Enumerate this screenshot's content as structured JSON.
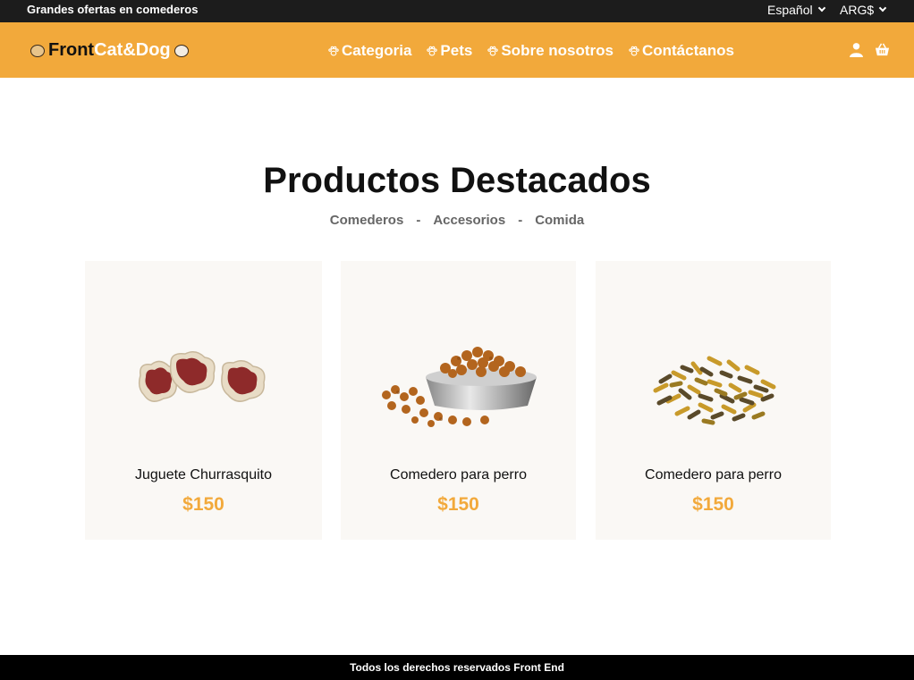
{
  "topbar": {
    "promo": "Grandes ofertas en comederos",
    "language": "Español",
    "currency": "ARG$"
  },
  "brand": {
    "part1": "Front",
    "part2": "Cat&Dog"
  },
  "nav": {
    "items": [
      {
        "label": "Categoria"
      },
      {
        "label": "Pets"
      },
      {
        "label": "Sobre nosotros"
      },
      {
        "label": "Contáctanos"
      }
    ]
  },
  "main": {
    "title": "Productos Destacados",
    "filters": [
      "Comederos",
      "Accesorios",
      "Comida"
    ],
    "separator": "-"
  },
  "products": [
    {
      "name": "Juguete Churrasquito",
      "price": "$150"
    },
    {
      "name": "Comedero para perro",
      "price": "$150"
    },
    {
      "name": "Comedero para perro",
      "price": "$150"
    }
  ],
  "footer": {
    "text": "Todos los derechos reservados Front End"
  },
  "colors": {
    "accent": "#f2a93b",
    "topbar": "#1c1c1c",
    "card_bg": "#faf8f5",
    "footer": "#000000"
  },
  "icons": [
    "paw-icon",
    "user-icon",
    "basket-icon",
    "chevron-down-icon"
  ]
}
